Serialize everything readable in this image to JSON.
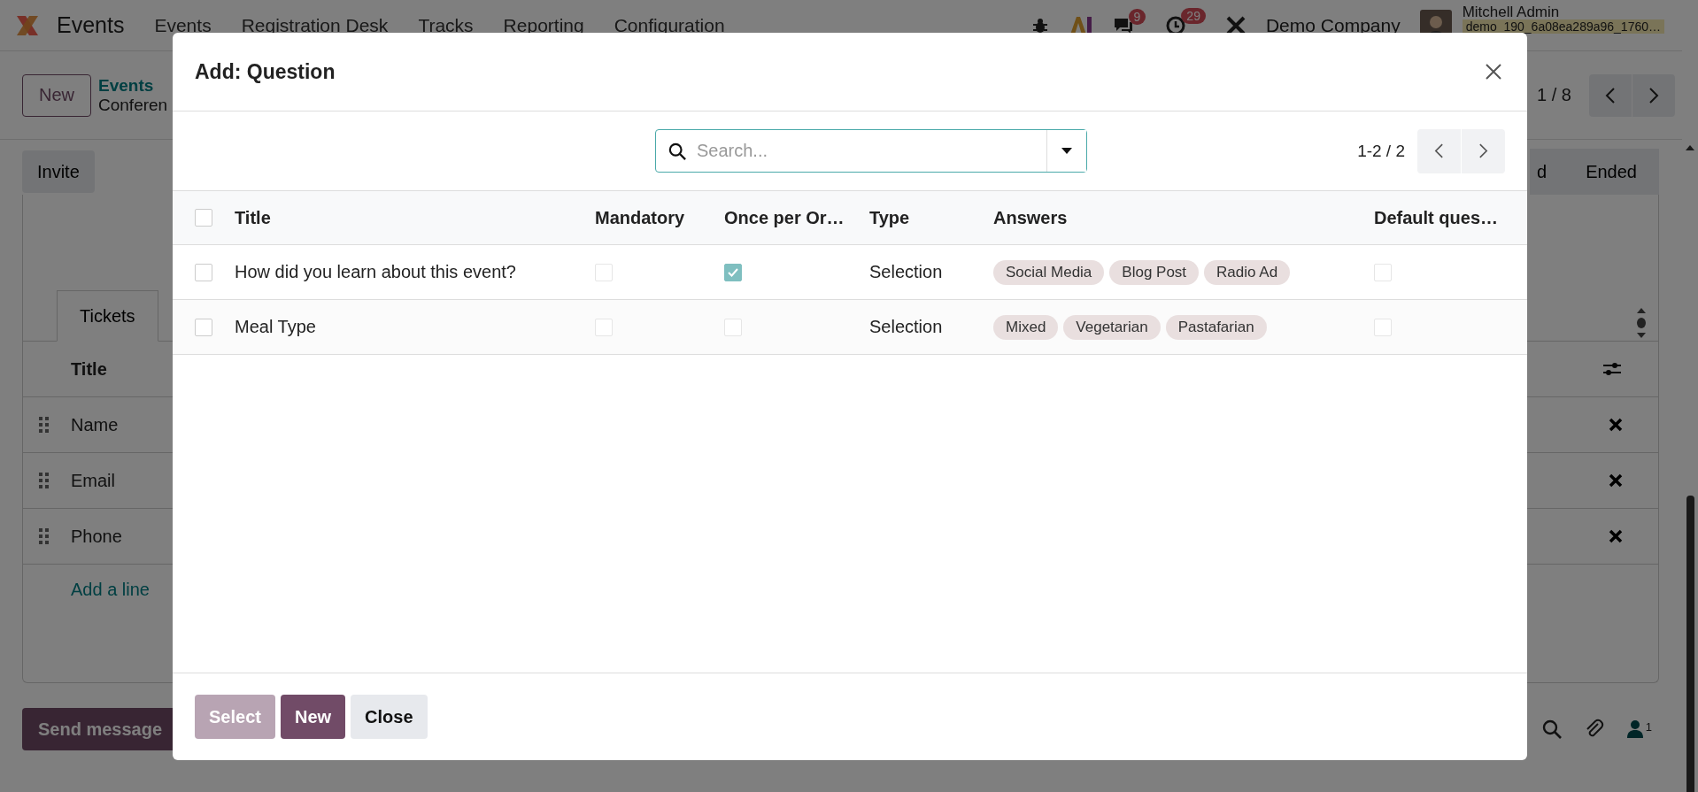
{
  "navbar": {
    "app_name": "Events",
    "menus": [
      "Events",
      "Registration Desk",
      "Tracks",
      "Reporting",
      "Configuration"
    ],
    "chat_count": "9",
    "activity_count": "29",
    "company": "Demo Company",
    "user": "Mitchell Admin",
    "database": "demo_190_6a08ea289a96_1760…"
  },
  "control_panel": {
    "new_button": "New",
    "breadcrumb": "Events",
    "record_title": "Conferen",
    "pager": "1 / 8"
  },
  "actions": {
    "invite_button": "Invite",
    "stages": [
      "d",
      "Ended"
    ]
  },
  "form": {
    "tabs": [
      {
        "label": "Tickets",
        "selected": true
      }
    ],
    "table": {
      "columns": [
        "Title"
      ],
      "rows": [
        "Name",
        "Email",
        "Phone"
      ],
      "add_line": "Add a line"
    }
  },
  "chatter": {
    "send_button": "Send message",
    "follower_count": "1"
  },
  "dialog": {
    "title": "Add: Question",
    "search": {
      "placeholder": "Search..."
    },
    "pager": "1-2 / 2",
    "all_selected": false,
    "columns": [
      "Title",
      "Mandatory",
      "Once per Or…",
      "Type",
      "Answers",
      "Default ques…"
    ],
    "rows": [
      {
        "selected": false,
        "title": "How did you learn about this event?",
        "mandatory": false,
        "once_per_order": true,
        "type": "Selection",
        "answers": [
          "Social Media",
          "Blog Post",
          "Radio Ad"
        ],
        "default_question": false
      },
      {
        "selected": false,
        "title": "Meal Type",
        "mandatory": false,
        "once_per_order": false,
        "type": "Selection",
        "answers": [
          "Mixed",
          "Vegetarian",
          "Pastafarian"
        ],
        "default_question": false
      }
    ],
    "buttons": [
      {
        "label": "Select",
        "kind": "primary",
        "disabled": true
      },
      {
        "label": "New",
        "kind": "primary",
        "disabled": false
      },
      {
        "label": "Close",
        "kind": "secondary",
        "disabled": false
      }
    ]
  }
}
